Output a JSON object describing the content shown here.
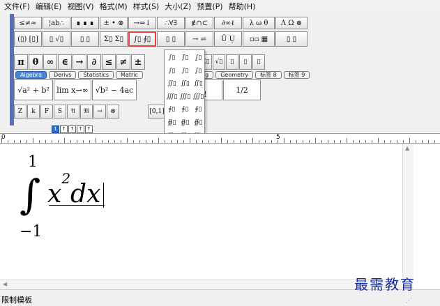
{
  "menu": [
    "文件(F)",
    "编辑(E)",
    "视图(V)",
    "格式(M)",
    "样式(S)",
    "大小(Z)",
    "预置(P)",
    "帮助(H)"
  ],
  "toolbar": {
    "row1": [
      "≤≠≈",
      "¦ab∴",
      "∎ ∎ ∎",
      "± • ⊗",
      "→⇔↓",
      "∴∀∃",
      "∉∩⊂",
      "∂∞ℓ",
      "λ ω θ",
      "Λ Ω ⊛"
    ],
    "row2": [
      "(▯) [▯]",
      "▯ √▯",
      "▯ ▯",
      "Σ▯ Σ▯",
      "∫▯ ∮▯",
      "▯ ▯",
      "→ ⇌",
      "Ū Ụ",
      "▫▫ ▦",
      "▯ ▯"
    ],
    "row2_active_index": 4,
    "row3": [
      "π",
      "θ",
      "∞",
      "∈",
      "→",
      "∂",
      "≤",
      "≠",
      "±"
    ],
    "row3_right": [
      "▯",
      "Σ▯",
      "√▯",
      "▯",
      "▯",
      "▯"
    ],
    "tabs": [
      "Algebra",
      "Derivs",
      "Statistics",
      "Matric",
      "Trig",
      "Geometry",
      "标签 8",
      "标签 9"
    ],
    "tabs_active_index": 0,
    "templates": [
      "√a² + b²",
      "lim x→∞",
      "√b² − 4ac",
      "n! / (n−r)!",
      "1/2"
    ],
    "row5": [
      "Z",
      "k",
      "F",
      "S",
      "𝔄",
      "𝔐",
      "→",
      "⊗",
      "[0,1]",
      "∞",
      "√"
    ],
    "lower_strip": [
      "1",
      "↑",
      "↑",
      "↑",
      "↑"
    ]
  },
  "palette": {
    "rows": [
      [
        "∫▯",
        "∫̇▯",
        "∫̣▯"
      ],
      [
        "∫▯",
        "∫▯",
        "∫▯"
      ],
      [
        "∬▯",
        "∬▯",
        "∬▯"
      ],
      [
        "∭▯",
        "∭▯",
        "∭▯"
      ],
      [
        "∮▯",
        "∮▯",
        "∮▯"
      ],
      [
        "∯▯",
        "∯▯",
        "∯▯"
      ],
      [
        "∰▯",
        "∰▯",
        "∰▯"
      ],
      [
        "∮▯",
        "∮▯",
        "∮▯"
      ],
      [
        "∮▯",
        "∮▯",
        "∮▯"
      ]
    ]
  },
  "ruler": {
    "labels": [
      "0",
      "5"
    ]
  },
  "equation": {
    "upper_limit": "1",
    "integral_sign": "∫",
    "integrand_base": "x",
    "integrand_exp": "2",
    "differential": "dx",
    "lower_limit": "−1"
  },
  "status": {
    "text": "限制模板"
  },
  "watermark": {
    "text": "最需教育"
  }
}
